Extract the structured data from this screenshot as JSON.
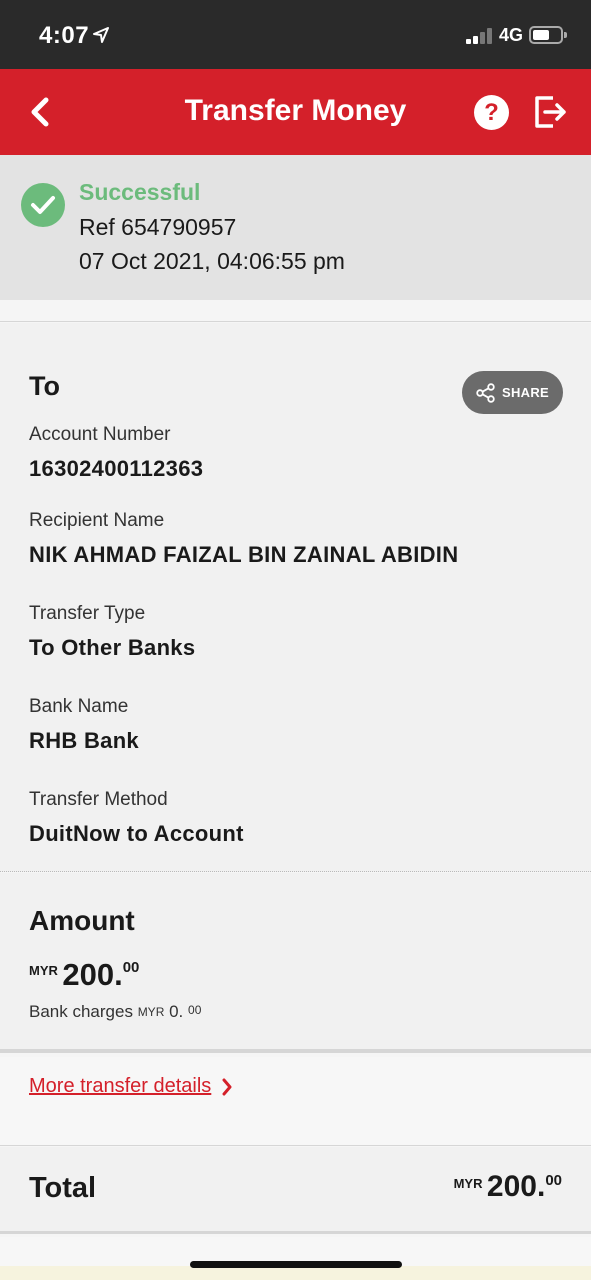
{
  "status_bar": {
    "time": "4:07",
    "network": "4G"
  },
  "header": {
    "title": "Transfer Money"
  },
  "status": {
    "title": "Successful",
    "reference": "Ref 654790957",
    "datetime": "07 Oct 2021, 04:06:55 pm"
  },
  "recipient": {
    "section_title": "To",
    "share_label": "SHARE",
    "fields": [
      {
        "label": "Account Number",
        "value": "16302400112363"
      },
      {
        "label": "Recipient Name",
        "value": "NIK AHMAD FAIZAL BIN ZAINAL ABIDIN"
      },
      {
        "label": "Transfer Type",
        "value": "To Other Banks"
      },
      {
        "label": "Bank Name",
        "value": "RHB Bank"
      },
      {
        "label": "Transfer Method",
        "value": "DuitNow to Account"
      }
    ]
  },
  "amount": {
    "section_title": "Amount",
    "currency": "MYR",
    "whole": "200.",
    "cents": "00",
    "charges_label": "Bank charges",
    "charges_currency": "MYR",
    "charges_whole": "0.",
    "charges_cents": "00"
  },
  "more_details": {
    "label": "More transfer details"
  },
  "total": {
    "label": "Total",
    "currency": "MYR",
    "whole": "200.",
    "cents": "00"
  },
  "colors": {
    "brand_red": "#d4202a",
    "success_green": "#6cbb7c",
    "share_gray": "#6b6b6b"
  }
}
